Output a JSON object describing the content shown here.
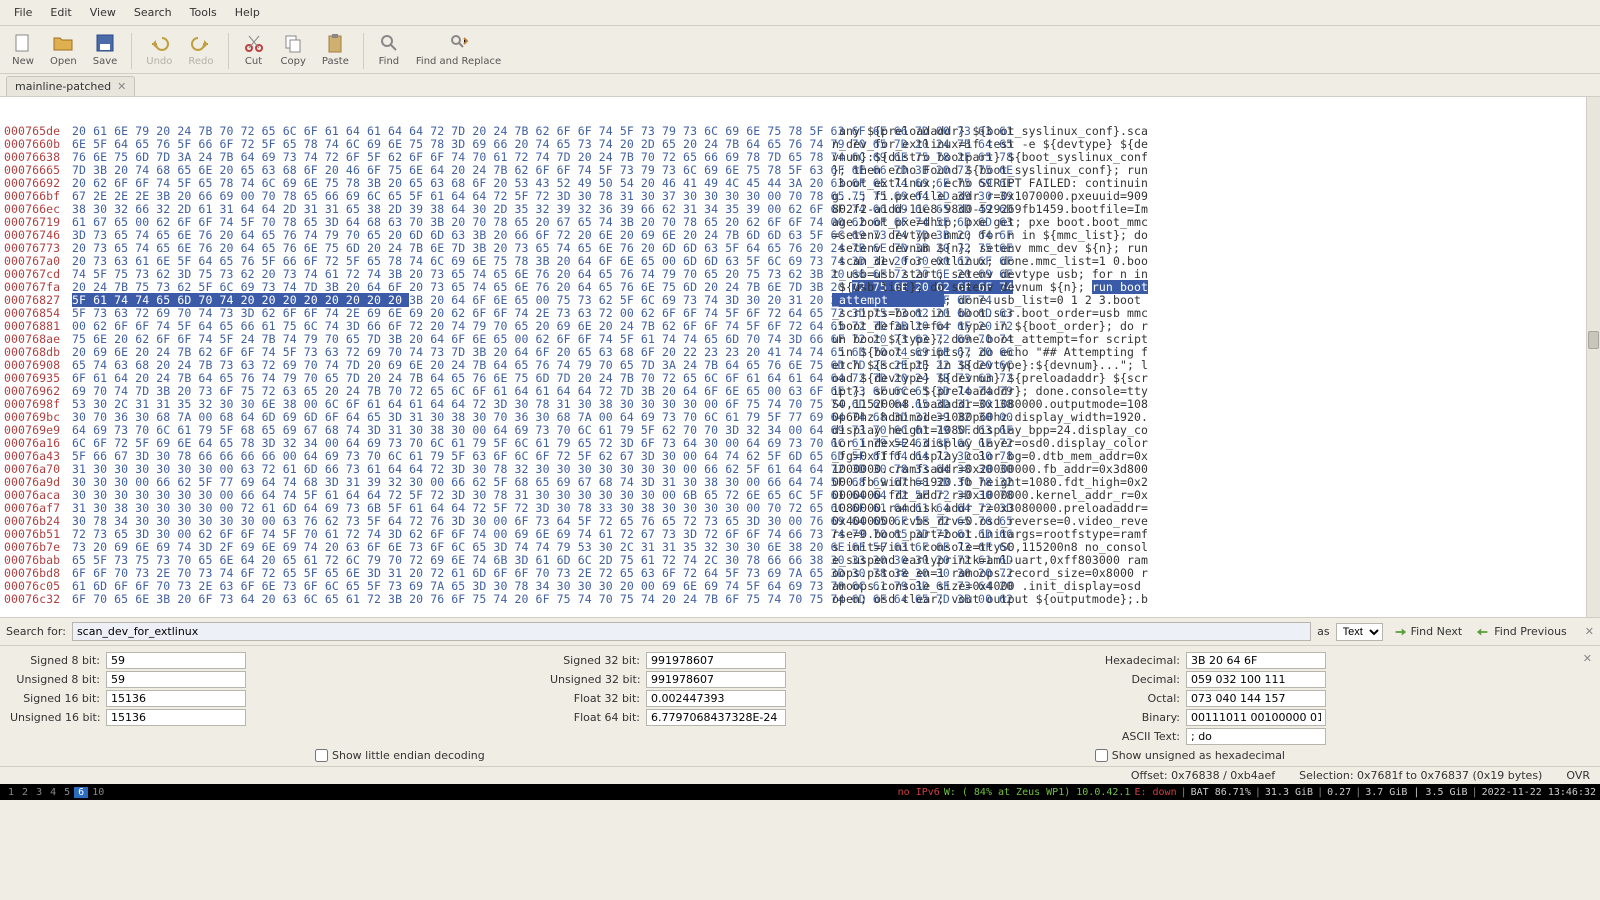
{
  "menus": [
    "File",
    "Edit",
    "View",
    "Search",
    "Tools",
    "Help"
  ],
  "toolbar": [
    {
      "n": "new",
      "l": "New"
    },
    {
      "n": "open",
      "l": "Open"
    },
    {
      "n": "save",
      "l": "Save"
    },
    {
      "sep": true
    },
    {
      "n": "undo",
      "l": "Undo",
      "d": true
    },
    {
      "n": "redo",
      "l": "Redo",
      "d": true
    },
    {
      "sep": true
    },
    {
      "n": "cut",
      "l": "Cut"
    },
    {
      "n": "copy",
      "l": "Copy"
    },
    {
      "n": "paste",
      "l": "Paste"
    },
    {
      "sep": true
    },
    {
      "n": "find",
      "l": "Find"
    },
    {
      "n": "findrepl",
      "l": "Find and Replace"
    }
  ],
  "tab": {
    "title": "mainline-patched"
  },
  "search": {
    "label": "Search for:",
    "value": "scan_dev_for_extlinux",
    "as": "as",
    "type": "Text",
    "findnext": "Find Next",
    "findprev": "Find Previous"
  },
  "decode": {
    "rows": [
      [
        {
          "k": "Signed 8 bit:",
          "v": "59"
        },
        {
          "k": "Signed 32 bit:",
          "v": "991978607"
        },
        {
          "k": "Hexadecimal:",
          "v": "3B 20 64 6F"
        }
      ],
      [
        {
          "k": "Unsigned 8 bit:",
          "v": "59"
        },
        {
          "k": "Unsigned 32 bit:",
          "v": "991978607"
        },
        {
          "k": "Decimal:",
          "v": "059 032 100 111"
        }
      ],
      [
        {
          "k": "Signed 16 bit:",
          "v": "15136"
        },
        {
          "k": "Float 32 bit:",
          "v": "0.002447393"
        },
        {
          "k": "Octal:",
          "v": "073 040 144 157"
        }
      ],
      [
        {
          "k": "Unsigned 16 bit:",
          "v": "15136"
        },
        {
          "k": "Float 64 bit:",
          "v": "6.7797068437328E-24"
        },
        {
          "k": "Binary:",
          "v": "00111011 00100000 01100100 01101111"
        }
      ],
      [
        null,
        null,
        {
          "k": "ASCII Text:",
          "v": "; do"
        }
      ]
    ],
    "check1": "Show little endian decoding",
    "check2": "Show unsigned as hexadecimal"
  },
  "offsetbar": {
    "offset": "Offset: 0x76838 / 0xb4aef",
    "sel": "Selection: 0x7681f to 0x76837 (0x19 bytes)",
    "ovr": "OVR"
  },
  "statusbar": {
    "workspaces": [
      "1",
      "2",
      "3",
      "4",
      "5",
      "6",
      "10"
    ],
    "active": "6",
    "noipv6": "no IPv6",
    "wifi": "W: ( 84% at Zeus WP1) 10.0.42.1",
    "eth": "E: down",
    "bat": "BAT 86.71%",
    "mem": "31.3 GiB",
    "load": "0.27",
    "disk": "3.7 GiB | 3.5 GiB",
    "clock": "2022-11-22 13:46:32"
  },
  "hex": {
    "lines": [
      {
        "a": "000765de",
        "h": "20 61 6E 79 20 24 7B 70 72 65 6C 6F 61 64 61 64 64 72 7D 20 24 7B 62 6F 6F 74 5F 73 79 73 6C 69 6E 75 78 5F 63 6F 6E 66 7D 00 73 63 61",
        "t": " any ${preloadaddr} ${boot_syslinux_conf}.sca"
      },
      {
        "a": "0007660b",
        "h": "6E 5F 64 65 76 5F 66 6F 72 5F 65 78 74 6C 69 6E 75 78 3D 69 66 20 74 65 73 74 20 2D 65 20 24 7B 64 65 76 74 79 70 65 7D 20 24 7B 64 65",
        "t": "n_dev_for_extlinux=if test -e ${devtype} ${de"
      },
      {
        "a": "00076638",
        "h": "76 6E 75 6D 7D 3A 24 7B 64 69 73 74 72 6F 5F 62 6F 6F 74 70 61 72 74 7D 20 24 7B 70 72 65 66 69 78 7D 65 78 74 6C 69 6E 75 78 2F 65 78",
        "t": "vnum}:${distro_bootpart} ${boot_syslinux_conf"
      },
      {
        "a": "00076665",
        "h": "7D 3B 20 74 68 65 6E 20 65 63 68 6F 20 46 6F 75 6E 64 20 24 7B 62 6F 6F 74 5F 73 79 73 6C 69 6E 75 78 5F 63 6F 6E 66 7D 3B 20 72 75 6E",
        "t": "}; then echo Found ${boot_syslinux_conf}; run"
      },
      {
        "a": "00076692",
        "h": "20 62 6F 6F 74 5F 65 78 74 6C 69 6E 75 78 3B 20 65 63 68 6F 20 53 43 52 49 50 54 20 46 41 49 4C 45 44 3A 20 63 6F 6E 74 69 6E 75 69 6E",
        "t": " boot_extlinux; echo SCRIPT FAILED: continuin"
      },
      {
        "a": "000766bf",
        "h": "67 2E 2E 2E 3B 20 66 69 00 70 78 65 66 69 6C 65 5F 61 64 64 72 5F 72 3D 30 78 31 30 37 30 30 30 30 00 70 78 65 75 75 69 64 3D 39 30 39",
        "t": "g...; fi.pxefile_addr_r=0x1070000.pxeuuid=909"
      },
      {
        "a": "000766ec",
        "h": "38 30 32 66 32 2D 61 31 64 64 2D 31 31 65 38 2D 39 38 64 30 2D 35 32 39 32 36 39 66 62 31 34 35 39 00 62 6F 6F 74 66 69 6C 65 3D 49 6D",
        "t": "802f2-a1dd-11e8-98d0-529269fb1459.bootfile=Im"
      },
      {
        "a": "00076719",
        "h": "61 67 65 00 62 6F 6F 74 5F 70 78 65 3D 64 68 63 70 3B 20 70 78 65 20 67 65 74 3B 20 70 78 65 20 62 6F 6F 74 00 62 6F 6F 74 5F 6D 6D 63",
        "t": "age.boot_pxe=dhcp; pxe get; pxe boot.boot_mmc"
      },
      {
        "a": "00076746",
        "h": "3D 73 65 74 65 6E 76 20 64 65 76 74 79 70 65 20 6D 6D 63 3B 20 66 6F 72 20 6E 20 69 6E 20 24 7B 6D 6D 63 5F 6C 69 73 74 7D 3B 20 64 6F",
        "t": "=setenv devtype mmc; for n in ${mmc_list}; do"
      },
      {
        "a": "00076773",
        "h": "20 73 65 74 65 6E 76 20 64 65 76 6E 75 6D 20 24 7B 6E 7D 3B 20 73 65 74 65 6E 76 20 6D 6D 63 5F 64 65 76 20 24 7B 6E 7D 3B 20 72 75 6E",
        "t": " setenv devnum ${n}; setenv mmc_dev ${n}; run"
      },
      {
        "a": "000767a0",
        "h": "20 73 63 61 6E 5F 64 65 76 5F 66 6F 72 5F 65 78 74 6C 69 6E 75 78 3B 20 64 6F 6E 65 00 6D 6D 63 5F 6C 69 73 74 3D 31 20 30 00 62 6F 6F",
        "t": " scan_dev_for_extlinux; done.mmc_list=1 0.boo"
      },
      {
        "a": "000767cd",
        "h": "74 5F 75 73 62 3D 75 73 62 20 73 74 61 72 74 3B 20 73 65 74 65 6E 76 20 64 65 76 74 79 70 65 20 75 73 62 3B 20 66 6F 72 20 6E 20 69 6E",
        "t": "t_usb=usb start; setenv devtype usb; for n in"
      },
      {
        "a": "000767fa",
        "h": "20 24 7B 75 73 62 5F 6C 69 73 74 7D 3B 20 64 6F 20 73 65 74 65 6E 76 20 64 65 76 6E 75 6D 20 24 7B 6E 7D 3B 20 ",
        "t": " ${usb_list}; do setenv devnum ${n}; ",
        "sh": "72 75 6E 20 62 6F 6F 74",
        "st": "run boot"
      },
      {
        "a": "00076827",
        "h2a": "5F 61 74 74 65 6D 70 74 20 20 20 20 20 20 20 20 ",
        "h2b": "3B 20 64 6F 6E 65 00 75 73 62 5F 6C 69 73 74 3D 30 20 31 20 32 20 33 00 62 6F 6F 74",
        "t2a": "_attempt        ",
        "t2b": "; done.usb_list=0 1 2 3.boot"
      },
      {
        "a": "00076854",
        "h": "5F 73 63 72 69 70 74 73 3D 62 6F 6F 74 2E 69 6E 69 20 62 6F 6F 74 2E 73 63 72 00 62 6F 6F 74 5F 6F 72 64 65 72 3D 75 73 62 20 6D 6D 63",
        "t": "_scripts=boot.ini boot.scr.boot_order=usb mmc"
      },
      {
        "a": "00076881",
        "h": "00 62 6F 6F 74 5F 64 65 66 61 75 6C 74 3D 66 6F 72 20 74 79 70 65 20 69 6E 20 24 7B 62 6F 6F 74 5F 6F 72 64 65 72 7D 3B 20 64 6F 20 72",
        "t": ".boot_default=for type in ${boot_order}; do r"
      },
      {
        "a": "000768ae",
        "h": "75 6E 20 62 6F 6F 74 5F 24 7B 74 79 70 65 7D 3B 20 64 6F 6E 65 00 62 6F 6F 74 5F 61 74 74 65 6D 70 74 3D 66 6F 72 20 73 63 72 69 70 74",
        "t": "un boot_${type}; done.boot_attempt=for script"
      },
      {
        "a": "000768db",
        "h": "20 69 6E 20 24 7B 62 6F 6F 74 5F 73 63 72 69 70 74 73 7D 3B 20 64 6F 20 65 63 68 6F 20 22 23 23 20 41 74 74 65 6D 70 74 69 6E 67 20 66",
        "t": " in ${boot_scripts}; do echo \"## Attempting f"
      },
      {
        "a": "00076908",
        "h": "65 74 63 68 20 24 7B 73 63 72 69 70 74 7D 20 69 6E 20 24 7B 64 65 76 74 79 70 65 7D 3A 24 7B 64 65 76 6E 75 6D 7D 2E 2E 2E 22 3B 20 6C",
        "t": "etch ${script} in ${devtype}:${devnum}...\"; l"
      },
      {
        "a": "00076935",
        "h": "6F 61 64 20 24 7B 64 65 76 74 79 70 65 7D 20 24 7B 64 65 76 6E 75 6D 7D 20 24 7B 70 72 65 6C 6F 61 64 61 64 64 72 7D 20 24 7B 73 63 72",
        "t": "oad ${devtype} ${devnum} ${preloadaddr} ${scr"
      },
      {
        "a": "00076962",
        "h": "69 70 74 7D 3B 20 73 6F 75 72 63 65 20 24 7B 70 72 65 6C 6F 61 64 61 64 64 72 7D 3B 20 64 6F 6E 65 00 63 6F 6E 73 6F 6C 65 3D 74 74 79",
        "t": "ipt}; source ${preloadaddr}; done.console=tty"
      },
      {
        "a": "0007698f",
        "h": "53 30 2C 31 31 35 32 30 30 6E 38 00 6C 6F 61 64 61 64 64 72 3D 30 78 31 30 38 30 30 30 30 00 6F 75 74 70 75 74 6D 6F 64 65 3D 31 30 38",
        "t": "S0,115200n8.loadaddr=0x1080000.outputmode=108"
      },
      {
        "a": "000769bc",
        "h": "30 70 36 30 68 7A 00 68 64 6D 69 6D 6F 64 65 3D 31 30 38 30 70 36 30 68 7A 00 64 69 73 70 6C 61 79 5F 77 69 64 74 68 3D 31 39 32 30 00",
        "t": "0p60hz.hdmimode=1080p60hz.display_width=1920."
      },
      {
        "a": "000769e9",
        "h": "64 69 73 70 6C 61 79 5F 68 65 69 67 68 74 3D 31 30 38 30 00 64 69 73 70 6C 61 79 5F 62 70 70 3D 32 34 00 64 69 73 70 6C 61 79 5F 63 6F",
        "t": "display_height=1080.display_bpp=24.display_co"
      },
      {
        "a": "00076a16",
        "h": "6C 6F 72 5F 69 6E 64 65 78 3D 32 34 00 64 69 73 70 6C 61 79 5F 6C 61 79 65 72 3D 6F 73 64 30 00 64 69 73 70 6C 61 79 5F 63 6F 6C 6F 72",
        "t": "lor_index=24.display_layer=osd0.display_color"
      },
      {
        "a": "00076a43",
        "h": "5F 66 67 3D 30 78 66 66 66 66 00 64 69 73 70 6C 61 79 5F 63 6F 6C 6F 72 5F 62 67 3D 30 00 64 74 62 5F 6D 65 6D 5F 61 64 64 72 3D 30 78",
        "t": "_fg=0xffff.display_color_bg=0.dtb_mem_addr=0x"
      },
      {
        "a": "00076a70",
        "h": "31 30 30 30 30 30 30 00 63 72 61 6D 66 73 61 64 64 72 3D 30 78 32 30 30 30 30 30 30 30 00 66 62 5F 61 64 64 72 3D 30 78 33 64 38 30 30",
        "t": "1000000.cramfsaddr=0x20000000.fb_addr=0x3d800"
      },
      {
        "a": "00076a9d",
        "h": "30 30 30 00 66 62 5F 77 69 64 74 68 3D 31 39 32 30 00 66 62 5F 68 65 69 67 68 74 3D 31 30 38 30 00 66 64 74 5F 68 69 67 68 3D 30 78 32",
        "t": "000.fb_width=1920.fb_height=1080.fdt_high=0x2"
      },
      {
        "a": "00076aca",
        "h": "30 30 30 30 30 30 30 00 66 64 74 5F 61 64 64 72 5F 72 3D 30 78 31 30 30 30 30 30 30 00 6B 65 72 6E 65 6C 5F 61 64 64 72 5F 72 3D 30 78",
        "t": "0000000.fdt_addr_r=0x1000000.kernel_addr_r=0x"
      },
      {
        "a": "00076af7",
        "h": "31 30 38 30 30 30 30 00 72 61 6D 64 69 73 6B 5F 61 64 64 72 5F 72 3D 30 78 33 30 38 30 30 30 30 00 70 72 65 6C 6F 61 64 61 64 64 72 3D",
        "t": "1080000.ramdisk_addr_r=0x3080000.preloadaddr="
      },
      {
        "a": "00076b24",
        "h": "30 78 34 30 30 30 30 30 30 00 63 76 62 73 5F 64 72 76 3D 30 00 6F 73 64 5F 72 65 76 65 72 73 65 3D 30 00 76 69 64 65 6F 5F 72 65 76 65",
        "t": "0x4000000.cvbs_drv=0.osd_reverse=0.video_reve"
      },
      {
        "a": "00076b51",
        "h": "72 73 65 3D 30 00 62 6F 6F 74 5F 70 61 72 74 3D 62 6F 6F 74 00 69 6E 69 74 61 72 67 73 3D 72 6F 6F 74 66 73 74 79 70 65 3D 72 61 6D 66",
        "t": "rse=0.boot_part=boot.initargs=rootfstype=ramf"
      },
      {
        "a": "00076b7e",
        "h": "73 20 69 6E 69 74 3D 2F 69 6E 69 74 20 63 6F 6E 73 6F 6C 65 3D 74 74 79 53 30 2C 31 31 35 32 30 30 6E 38 20 6E 6F 5F 63 6F 6E 73 6F 6C",
        "t": "s init=/init console=ttyS0,115200n8 no_consol"
      },
      {
        "a": "00076bab",
        "h": "65 5F 73 75 73 70 65 6E 64 20 65 61 72 6C 79 70 72 69 6E 74 6B 3D 61 6D 6C 2D 75 61 72 74 2C 30 78 66 66 38 30 33 30 30 30 20 72 61 6D",
        "t": "e_suspend earlyprintk=aml-uart,0xff803000 ram"
      },
      {
        "a": "00076bd8",
        "h": "6F 6F 70 73 2E 70 73 74 6F 72 65 5F 65 6E 3D 31 20 72 61 6D 6F 6F 70 73 2E 72 65 63 6F 72 64 5F 73 69 7A 65 3D 30 78 38 30 30 30 20 72",
        "t": "oops.pstore_en=1 ramoops.record_size=0x8000 r"
      },
      {
        "a": "00076c05",
        "h": "61 6D 6F 6F 70 73 2E 63 6F 6E 73 6F 6C 65 5F 73 69 7A 65 3D 30 78 34 30 30 30 20 00 69 6E 69 74 5F 64 69 73 70 6C 61 79 3D 6F 73 64 20",
        "t": "amoops.console_size=0x4000 .init_display=osd "
      },
      {
        "a": "00076c32",
        "h": "6F 70 65 6E 3B 20 6F 73 64 20 63 6C 65 61 72 3B 20 76 6F 75 74 20 6F 75 74 70 75 74 20 24 7B 6F 75 74 70 75 74 6D 6F 64 65 7D 3B 00 62",
        "t": "open; osd clear; vout output ${outputmode};.b"
      }
    ]
  }
}
